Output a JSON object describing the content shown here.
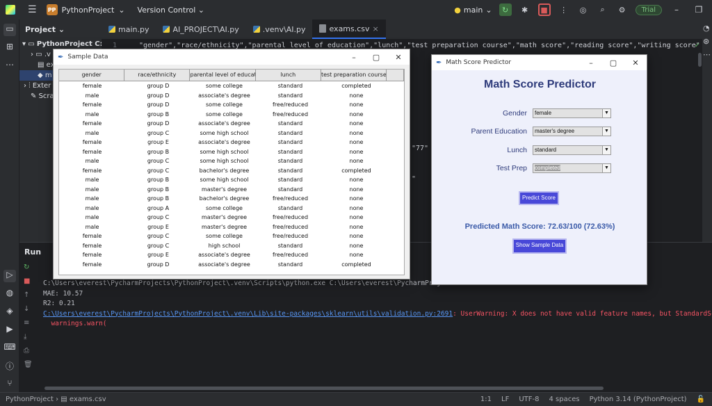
{
  "ide": {
    "project_badge": "PP",
    "project_name": "PythonProject",
    "version_control": "Version Control",
    "run_config": "main",
    "trial": "Trial"
  },
  "project_panel": {
    "title": "Project",
    "tree": [
      "PythonProject C:\\",
      ".v",
      "ex",
      "m",
      "Exter",
      "Scrat"
    ]
  },
  "tabs": [
    {
      "label": "main.py",
      "icon": "python-file-icon"
    },
    {
      "label": "AI_PROJECT\\AI.py",
      "icon": "python-file-icon"
    },
    {
      "label": ".venv\\AI.py",
      "icon": "python-file-icon"
    },
    {
      "label": "exams.csv",
      "icon": "csv-file-icon",
      "active": true
    }
  ],
  "editor": {
    "line_number": "1",
    "line1": "\"gender\",\"race/ethnicity\",\"parental level of education\",\"lunch\",\"test preparation course\",\"math score\",\"reading score\",\"writing score\"",
    "frag_77": "\"77\"",
    "frag_quote": "\""
  },
  "run_panel": {
    "title": "Run",
    "console_cmd": "C:\\Users\\everest\\PycharmProjects\\PythonProject\\.venv\\Scripts\\python.exe C:\\Users\\everest\\PycharmProject",
    "mae": "MAE: 10.57",
    "r2": "R2: 0.21",
    "warn_path": "C:\\Users\\everest\\PycharmProjects\\PythonProject\\.venv\\Lib\\site-packages\\sklearn\\utils\\validation.py:2691",
    "warn_msg": ": UserWarning: X does not have valid feature names, but StandardScaler wa",
    "warn_call": "warnings.warn("
  },
  "status_bar": {
    "breadcrumb_project": "PythonProject",
    "breadcrumb_file": "exams.csv",
    "position": "1:1",
    "line_sep": "LF",
    "encoding": "UTF-8",
    "indent": "4 spaces",
    "interpreter": "Python 3.14 (PythonProject)"
  },
  "sample_window": {
    "title": "Sample Data",
    "columns": [
      "gender",
      "race/ethnicity",
      "parental level of educatio",
      "lunch",
      "test preparation course"
    ],
    "rows": [
      [
        "female",
        "group D",
        "some college",
        "standard",
        "completed"
      ],
      [
        "male",
        "group D",
        "associate's degree",
        "standard",
        "none"
      ],
      [
        "female",
        "group D",
        "some college",
        "free/reduced",
        "none"
      ],
      [
        "male",
        "group B",
        "some college",
        "free/reduced",
        "none"
      ],
      [
        "female",
        "group D",
        "associate's degree",
        "standard",
        "none"
      ],
      [
        "male",
        "group C",
        "some high school",
        "standard",
        "none"
      ],
      [
        "female",
        "group E",
        "associate's degree",
        "standard",
        "none"
      ],
      [
        "female",
        "group B",
        "some high school",
        "standard",
        "none"
      ],
      [
        "male",
        "group C",
        "some high school",
        "standard",
        "none"
      ],
      [
        "female",
        "group C",
        "bachelor's degree",
        "standard",
        "completed"
      ],
      [
        "male",
        "group B",
        "some high school",
        "standard",
        "none"
      ],
      [
        "male",
        "group B",
        "master's degree",
        "standard",
        "none"
      ],
      [
        "male",
        "group B",
        "bachelor's degree",
        "free/reduced",
        "none"
      ],
      [
        "male",
        "group A",
        "some college",
        "standard",
        "none"
      ],
      [
        "male",
        "group C",
        "master's degree",
        "free/reduced",
        "none"
      ],
      [
        "male",
        "group E",
        "master's degree",
        "free/reduced",
        "none"
      ],
      [
        "female",
        "group C",
        "some college",
        "free/reduced",
        "none"
      ],
      [
        "female",
        "group C",
        "high school",
        "standard",
        "none"
      ],
      [
        "female",
        "group E",
        "associate's degree",
        "free/reduced",
        "none"
      ],
      [
        "female",
        "group D",
        "associate's degree",
        "standard",
        "completed"
      ]
    ]
  },
  "predictor_window": {
    "title": "Math Score Predictor",
    "heading": "Math Score Predictor",
    "fields": [
      {
        "label": "Gender",
        "value": "female"
      },
      {
        "label": "Parent Education",
        "value": "master's degree"
      },
      {
        "label": "Lunch",
        "value": "standard"
      },
      {
        "label": "Test Prep",
        "value": "completed"
      }
    ],
    "predict_button": "Predict Score",
    "result": "Predicted Math Score: 72.63/100 (72.63%)",
    "sample_button": "Show Sample Data"
  }
}
